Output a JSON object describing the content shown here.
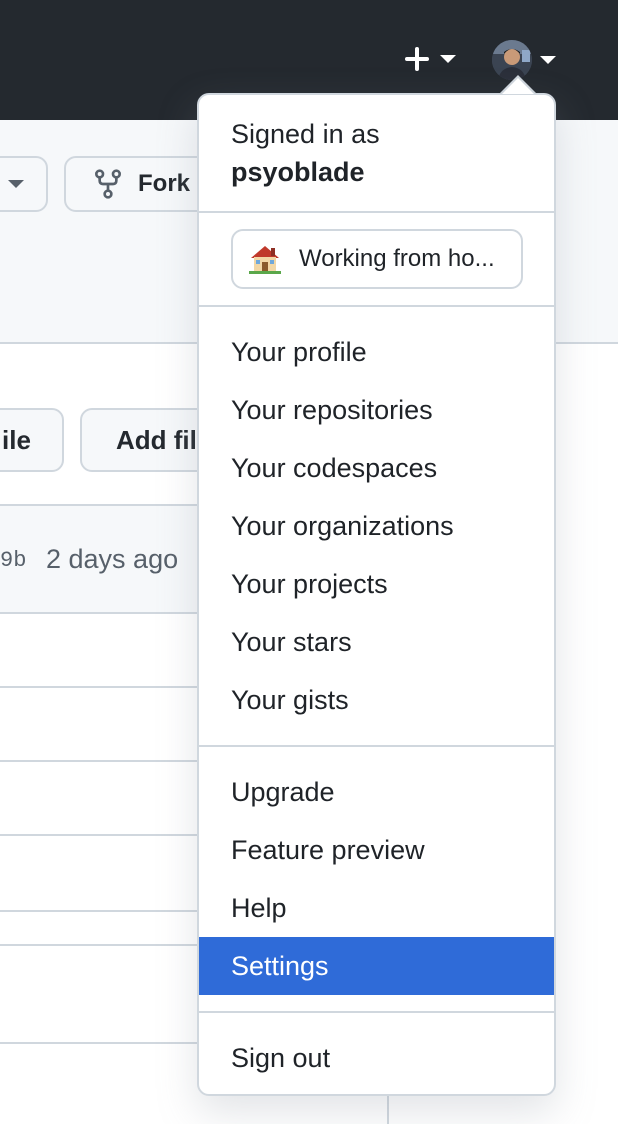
{
  "header": {
    "new_icon": "plus-icon",
    "avatar_icon": "user-avatar"
  },
  "repo": {
    "fork_label": "Fork",
    "file_button_partial": "ile",
    "add_file_partial": "Add fil",
    "commit_hash_partial": "9b",
    "commit_time": "2 days ago"
  },
  "menu": {
    "signed_in_label": "Signed in as",
    "username": "psyoblade",
    "status": {
      "emoji_icon": "house-icon",
      "text": "Working from ho..."
    },
    "profile_items": [
      {
        "label": "Your profile"
      },
      {
        "label": "Your repositories"
      },
      {
        "label": "Your codespaces"
      },
      {
        "label": "Your organizations"
      },
      {
        "label": "Your projects"
      },
      {
        "label": "Your stars"
      },
      {
        "label": "Your gists"
      }
    ],
    "account_items": [
      {
        "label": "Upgrade"
      },
      {
        "label": "Feature preview"
      },
      {
        "label": "Help"
      },
      {
        "label": "Settings",
        "highlighted": true
      }
    ],
    "sign_out_label": "Sign out"
  },
  "colors": {
    "header_bg": "#24292f",
    "highlight": "#2f6bd8",
    "border": "#d0d7de"
  }
}
